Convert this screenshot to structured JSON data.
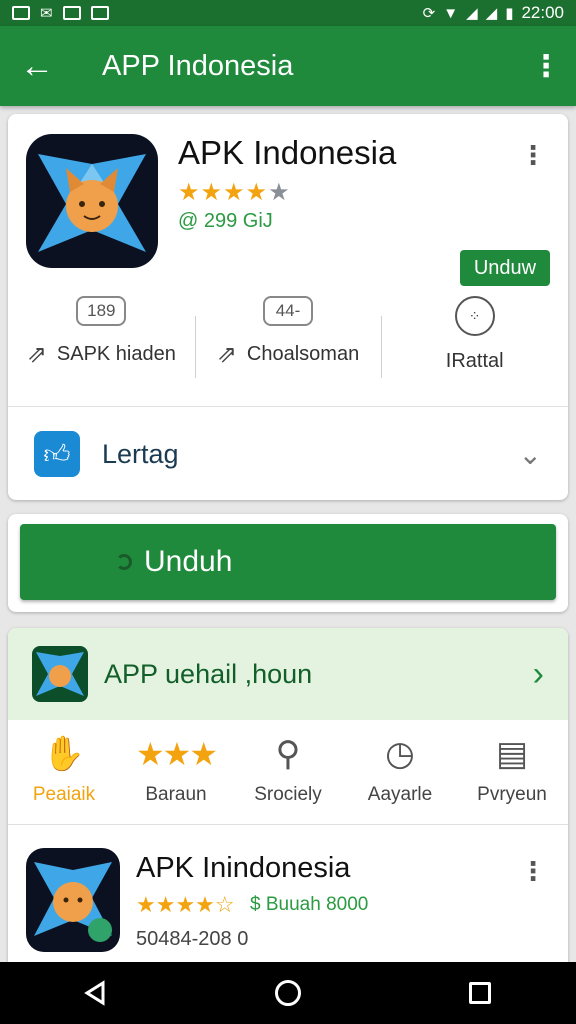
{
  "status_bar": {
    "time": "22:00",
    "icons": [
      "sim-icon",
      "notification-icon",
      "image-icon",
      "chart-icon",
      "nfc-icon",
      "wifi-icon",
      "signal-icon",
      "signal-icon",
      "battery-icon"
    ]
  },
  "app_bar": {
    "title": "APP Indonesia",
    "back_icon": "arrow-left-icon",
    "menu_icon": "more-vert-icon"
  },
  "app": {
    "name": "APK Indonesia",
    "rating_stars": "★★★★",
    "rating_half": "★",
    "size": "@ 299 GiJ",
    "install_label": "Unduw",
    "stats": [
      {
        "badge": "189",
        "label": "SAPK hiaden",
        "icon": "share-icon"
      },
      {
        "badge": "44-",
        "label": "Choalsoman",
        "icon": "share-icon"
      },
      {
        "badge": "",
        "label": "IRattal",
        "icon": "dots-circle-icon"
      }
    ],
    "category_label": "Lertag"
  },
  "download_button": {
    "label": "Unduh"
  },
  "detail": {
    "label": "APP uehail ,houn"
  },
  "categories": [
    {
      "label": "Peaiaik",
      "icon": "thumb-icon"
    },
    {
      "label": "Baraun",
      "icon": "star-icon"
    },
    {
      "label": "Srociely",
      "icon": "search-icon"
    },
    {
      "label": "Aayarle",
      "icon": "clock-icon"
    },
    {
      "label": "Pvryeun",
      "icon": "message-icon"
    }
  ],
  "app2": {
    "name": "APK Inindonesia",
    "rating": "★★★★☆",
    "price": "$ Buuah 8000",
    "count": "50484-208 0"
  },
  "colors": {
    "primary": "#1f8a3c",
    "status": "#1b6f2f",
    "star": "#f2a30f",
    "detail_bg": "#e3f3e0"
  }
}
